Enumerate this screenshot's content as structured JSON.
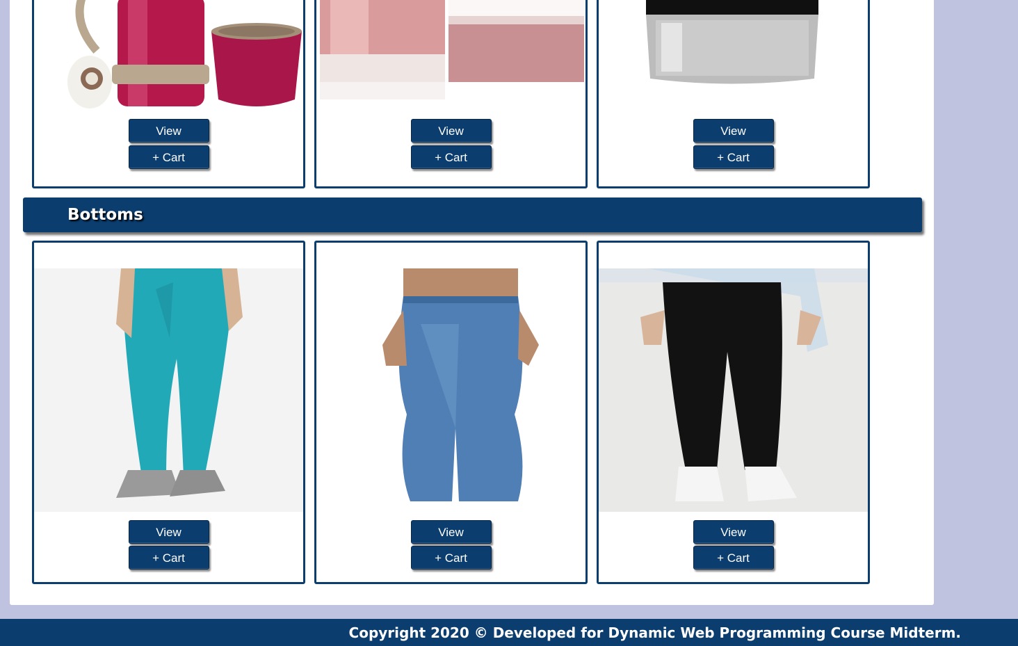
{
  "colors": {
    "brand": "#0b3d6e",
    "page_background": "#bfc3df",
    "panel_background": "#ffffff"
  },
  "top_row": {
    "products": [
      {
        "image": "red-thermos-flask-image",
        "view_label": "View",
        "cart_label": "+ Cart"
      },
      {
        "image": "guerlain-perfume-bottle-image",
        "view_label": "View",
        "cart_label": "+ Cart"
      },
      {
        "image": "black-cap-cream-jar-image",
        "view_label": "View",
        "cart_label": "+ Cart"
      }
    ]
  },
  "bottoms_section": {
    "title": "Bottoms",
    "products": [
      {
        "image": "teal-leggings-image",
        "view_label": "View",
        "cart_label": "+ Cart"
      },
      {
        "image": "flared-blue-jeans-image",
        "view_label": "View",
        "cart_label": "+ Cart"
      },
      {
        "image": "black-skinny-jeans-image",
        "view_label": "View",
        "cart_label": "+ Cart"
      }
    ]
  },
  "footer": {
    "text": "Copyright 2020 © Developed for Dynamic Web Programming Course Midterm."
  }
}
